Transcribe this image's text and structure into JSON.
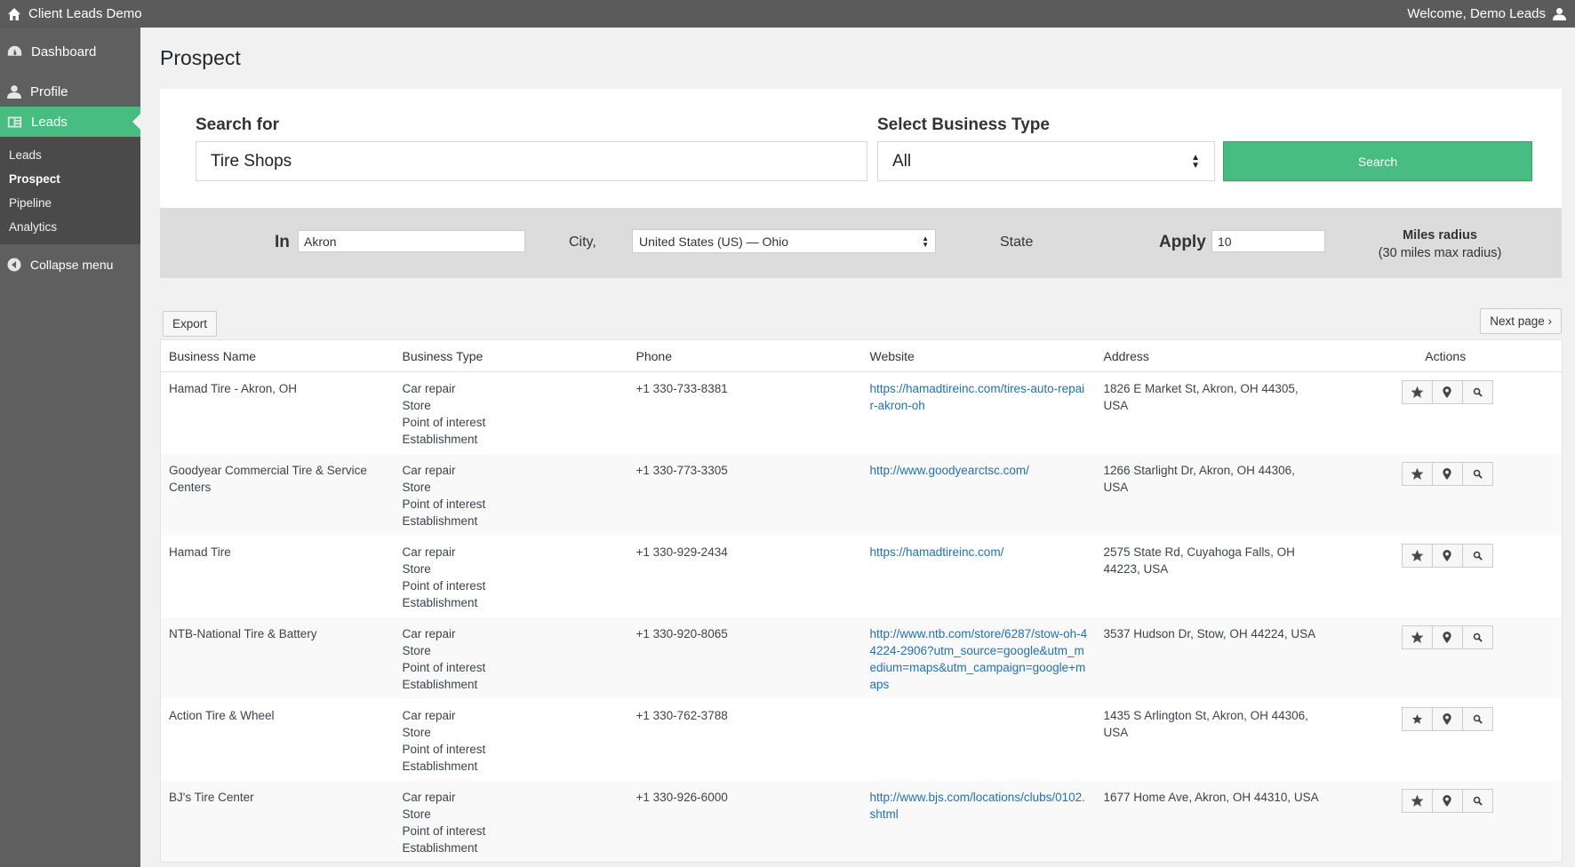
{
  "adminbar": {
    "site_title": "Client Leads Demo",
    "welcome": "Welcome, Demo Leads"
  },
  "sidebar": {
    "items": [
      {
        "label": "Dashboard",
        "icon": "dashboard-icon"
      },
      {
        "label": "Profile",
        "icon": "user-icon"
      },
      {
        "label": "Leads",
        "icon": "leads-icon"
      }
    ],
    "submenu": [
      "Leads",
      "Prospect",
      "Pipeline",
      "Analytics"
    ],
    "collapse_label": "Collapse menu"
  },
  "page": {
    "title": "Prospect"
  },
  "search": {
    "search_for_label": "Search for",
    "search_for_value": "Tire Shops",
    "business_type_label": "Select Business Type",
    "business_type_value": "All",
    "search_button": "Search"
  },
  "filter": {
    "in_label": "In",
    "city_value": "Akron",
    "city_label": "City,",
    "state_select_value": "United States (US) — Ohio",
    "state_label": "State",
    "apply_label": "Apply",
    "radius_value": "10",
    "radius_label": "Miles radius",
    "radius_note": "(30 miles max radius)"
  },
  "controls": {
    "export": "Export",
    "next_page": "Next page ›"
  },
  "table": {
    "headers": [
      "Business Name",
      "Business Type",
      "Phone",
      "Website",
      "Address",
      "Actions"
    ],
    "rows": [
      {
        "name": "Hamad Tire - Akron, OH",
        "types": [
          "Car repair",
          "Store",
          "Point of interest",
          "Establishment"
        ],
        "phone": "+1 330-733-8381",
        "website": "https://hamadtireinc.com/tires-auto-repair-akron-oh",
        "address": "1826 E Market St, Akron, OH 44305, USA",
        "starred": false
      },
      {
        "name": "Goodyear Commercial Tire & Service Centers",
        "types": [
          "Car repair",
          "Store",
          "Point of interest",
          "Establishment"
        ],
        "phone": "+1 330-773-3305",
        "website": "http://www.goodyearctsc.com/",
        "address": "1266 Starlight Dr, Akron, OH 44306, USA",
        "starred": false
      },
      {
        "name": "Hamad Tire",
        "types": [
          "Car repair",
          "Store",
          "Point of interest",
          "Establishment"
        ],
        "phone": "+1 330-929-2434",
        "website": "https://hamadtireinc.com/",
        "address": "2575 State Rd, Cuyahoga Falls, OH 44223, USA",
        "starred": false
      },
      {
        "name": "NTB-National Tire & Battery",
        "types": [
          "Car repair",
          "Store",
          "Point of interest",
          "Establishment"
        ],
        "phone": "+1 330-920-8065",
        "website": "http://www.ntb.com/store/6287/stow-oh-44224-2906?utm_source=google&utm_medium=maps&utm_campaign=google+maps",
        "address": "3537 Hudson Dr, Stow, OH 44224, USA",
        "starred": false
      },
      {
        "name": "Action Tire & Wheel",
        "types": [
          "Car repair",
          "Store",
          "Point of interest",
          "Establishment"
        ],
        "phone": "+1 330-762-3788",
        "website": "",
        "address": "1435 S Arlington St, Akron, OH 44306, USA",
        "starred": true
      },
      {
        "name": "BJ's Tire Center",
        "types": [
          "Car repair",
          "Store",
          "Point of interest",
          "Establishment"
        ],
        "phone": "+1 330-926-6000",
        "website": "http://www.bjs.com/locations/clubs/0102.shtml",
        "address": "1677 Home Ave, Akron, OH 44310, USA",
        "starred": false
      }
    ]
  }
}
